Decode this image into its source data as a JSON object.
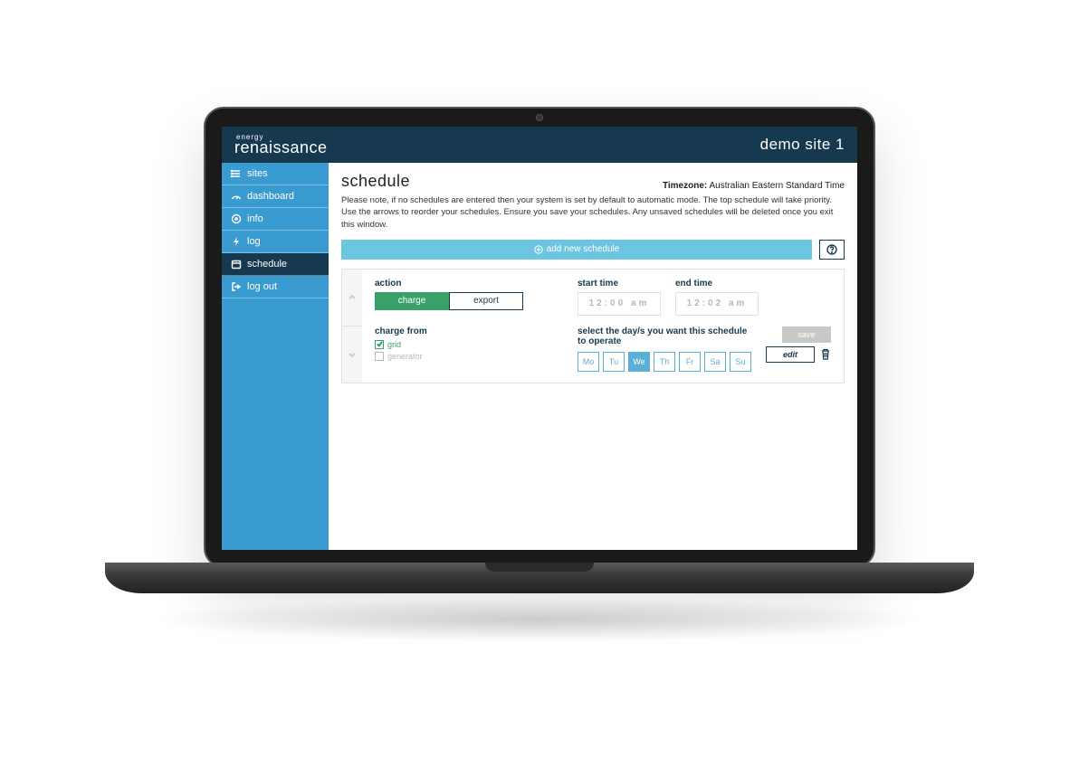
{
  "header": {
    "logo_top": "energy",
    "logo_bottom": "renaissance",
    "site_label": "demo site 1"
  },
  "sidebar": {
    "items": [
      {
        "id": "sites",
        "label": "sites"
      },
      {
        "id": "dashboard",
        "label": "dashboard"
      },
      {
        "id": "info",
        "label": "info"
      },
      {
        "id": "log",
        "label": "log"
      },
      {
        "id": "schedule",
        "label": "schedule",
        "active": true
      },
      {
        "id": "logout",
        "label": "log out"
      }
    ]
  },
  "page": {
    "title": "schedule",
    "timezone_label": "Timezone:",
    "timezone_value": "Australian Eastern Standard Time",
    "note": "Please note, if no schedules are entered then your system is set by default to automatic mode. The top schedule will take priority. Use the arrows to reorder your schedules. Ensure you save your schedules. Any unsaved schedules will be deleted once you exit this window.",
    "add_button": "add new schedule",
    "card": {
      "action_label": "action",
      "action_charge": "charge",
      "action_export": "export",
      "start_label": "start time",
      "end_label": "end time",
      "start_value": "12:00 am",
      "end_value": "12:02 am",
      "charge_from_label": "charge from",
      "grid_label": "grid",
      "generator_label": "generator",
      "days_label": "select the day/s you want this schedule to operate",
      "days": [
        "Mo",
        "Tu",
        "We",
        "Th",
        "Fr",
        "Sa",
        "Su"
      ],
      "days_selected": [
        false,
        false,
        true,
        false,
        false,
        false,
        false
      ],
      "save_label": "save",
      "edit_label": "edit"
    }
  }
}
